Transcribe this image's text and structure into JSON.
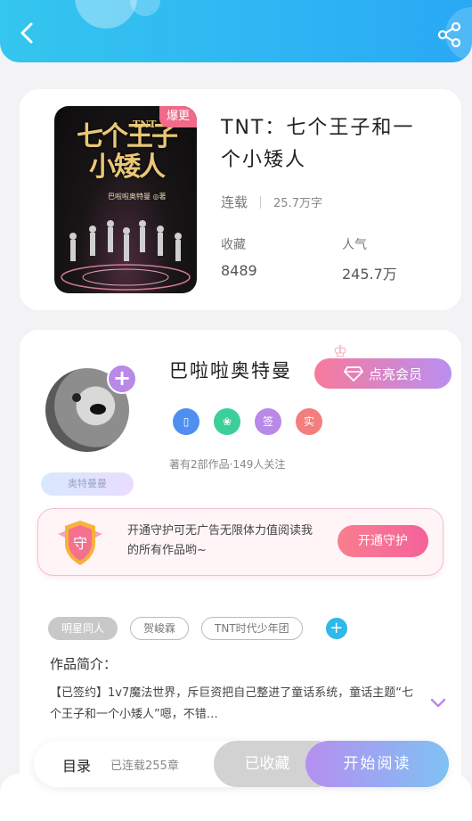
{
  "header": {
    "back_icon": "chevron-left-icon",
    "share_icon": "share-icon",
    "color_from": "#34c6ee",
    "color_to": "#29a9f5"
  },
  "book": {
    "title": "TNT：七个王子和一个小矮人",
    "status": "连载",
    "word_count": "25.7万字",
    "cover": {
      "title_line1": "七个王子",
      "title_line2": "小矮人",
      "he": "和",
      "tnt": "TNT",
      "author": "巴啦啦奥特曼 ◎著",
      "badge": "爆更"
    },
    "collect_label": "收藏",
    "collect_value": "8489",
    "popularity_label": "人气",
    "popularity_value": "245.7万"
  },
  "author": {
    "name": "巴啦啦奥特曼",
    "tag": "奥特曼曼",
    "vip_button": "点亮会员",
    "badges": [
      "▯",
      "❀",
      "签",
      "实"
    ],
    "stats": "著有2部作品·149人关注"
  },
  "guard": {
    "shield_char": "守",
    "text": "开通守护可无广告无限体力值阅读我的所有作品哟~",
    "button": "开通守护"
  },
  "tags": [
    "明星同人",
    "贺峻霖",
    "TNT时代少年团"
  ],
  "intro": {
    "heading": "作品简介：",
    "text": "【已签约】1v7魔法世界，斥巨资把自己整进了童话系统，童话主题“七个王子和一个小矮人”嗯，不错…"
  },
  "bottom": {
    "toc_label": "目录",
    "toc_count": "已连载255章",
    "collected_label": "已收藏",
    "read_button": "开始阅读"
  },
  "colors": {
    "accent_pink": "#f4629a",
    "accent_purple": "#b58ff0",
    "accent_blue": "#2fb8ea"
  }
}
